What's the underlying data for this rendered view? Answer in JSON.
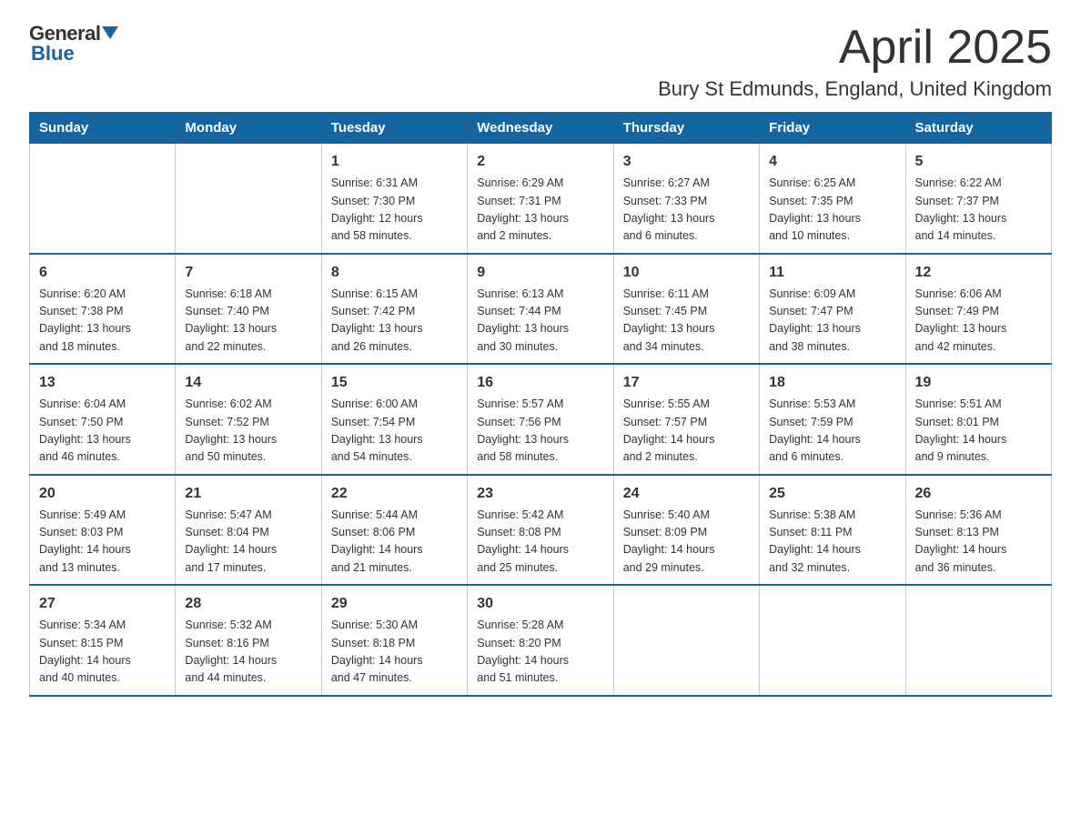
{
  "logo": {
    "general": "General",
    "blue": "Blue"
  },
  "header": {
    "month": "April 2025",
    "location": "Bury St Edmunds, England, United Kingdom"
  },
  "weekdays": [
    "Sunday",
    "Monday",
    "Tuesday",
    "Wednesday",
    "Thursday",
    "Friday",
    "Saturday"
  ],
  "weeks": [
    [
      {
        "day": "",
        "info": ""
      },
      {
        "day": "",
        "info": ""
      },
      {
        "day": "1",
        "info": "Sunrise: 6:31 AM\nSunset: 7:30 PM\nDaylight: 12 hours\nand 58 minutes."
      },
      {
        "day": "2",
        "info": "Sunrise: 6:29 AM\nSunset: 7:31 PM\nDaylight: 13 hours\nand 2 minutes."
      },
      {
        "day": "3",
        "info": "Sunrise: 6:27 AM\nSunset: 7:33 PM\nDaylight: 13 hours\nand 6 minutes."
      },
      {
        "day": "4",
        "info": "Sunrise: 6:25 AM\nSunset: 7:35 PM\nDaylight: 13 hours\nand 10 minutes."
      },
      {
        "day": "5",
        "info": "Sunrise: 6:22 AM\nSunset: 7:37 PM\nDaylight: 13 hours\nand 14 minutes."
      }
    ],
    [
      {
        "day": "6",
        "info": "Sunrise: 6:20 AM\nSunset: 7:38 PM\nDaylight: 13 hours\nand 18 minutes."
      },
      {
        "day": "7",
        "info": "Sunrise: 6:18 AM\nSunset: 7:40 PM\nDaylight: 13 hours\nand 22 minutes."
      },
      {
        "day": "8",
        "info": "Sunrise: 6:15 AM\nSunset: 7:42 PM\nDaylight: 13 hours\nand 26 minutes."
      },
      {
        "day": "9",
        "info": "Sunrise: 6:13 AM\nSunset: 7:44 PM\nDaylight: 13 hours\nand 30 minutes."
      },
      {
        "day": "10",
        "info": "Sunrise: 6:11 AM\nSunset: 7:45 PM\nDaylight: 13 hours\nand 34 minutes."
      },
      {
        "day": "11",
        "info": "Sunrise: 6:09 AM\nSunset: 7:47 PM\nDaylight: 13 hours\nand 38 minutes."
      },
      {
        "day": "12",
        "info": "Sunrise: 6:06 AM\nSunset: 7:49 PM\nDaylight: 13 hours\nand 42 minutes."
      }
    ],
    [
      {
        "day": "13",
        "info": "Sunrise: 6:04 AM\nSunset: 7:50 PM\nDaylight: 13 hours\nand 46 minutes."
      },
      {
        "day": "14",
        "info": "Sunrise: 6:02 AM\nSunset: 7:52 PM\nDaylight: 13 hours\nand 50 minutes."
      },
      {
        "day": "15",
        "info": "Sunrise: 6:00 AM\nSunset: 7:54 PM\nDaylight: 13 hours\nand 54 minutes."
      },
      {
        "day": "16",
        "info": "Sunrise: 5:57 AM\nSunset: 7:56 PM\nDaylight: 13 hours\nand 58 minutes."
      },
      {
        "day": "17",
        "info": "Sunrise: 5:55 AM\nSunset: 7:57 PM\nDaylight: 14 hours\nand 2 minutes."
      },
      {
        "day": "18",
        "info": "Sunrise: 5:53 AM\nSunset: 7:59 PM\nDaylight: 14 hours\nand 6 minutes."
      },
      {
        "day": "19",
        "info": "Sunrise: 5:51 AM\nSunset: 8:01 PM\nDaylight: 14 hours\nand 9 minutes."
      }
    ],
    [
      {
        "day": "20",
        "info": "Sunrise: 5:49 AM\nSunset: 8:03 PM\nDaylight: 14 hours\nand 13 minutes."
      },
      {
        "day": "21",
        "info": "Sunrise: 5:47 AM\nSunset: 8:04 PM\nDaylight: 14 hours\nand 17 minutes."
      },
      {
        "day": "22",
        "info": "Sunrise: 5:44 AM\nSunset: 8:06 PM\nDaylight: 14 hours\nand 21 minutes."
      },
      {
        "day": "23",
        "info": "Sunrise: 5:42 AM\nSunset: 8:08 PM\nDaylight: 14 hours\nand 25 minutes."
      },
      {
        "day": "24",
        "info": "Sunrise: 5:40 AM\nSunset: 8:09 PM\nDaylight: 14 hours\nand 29 minutes."
      },
      {
        "day": "25",
        "info": "Sunrise: 5:38 AM\nSunset: 8:11 PM\nDaylight: 14 hours\nand 32 minutes."
      },
      {
        "day": "26",
        "info": "Sunrise: 5:36 AM\nSunset: 8:13 PM\nDaylight: 14 hours\nand 36 minutes."
      }
    ],
    [
      {
        "day": "27",
        "info": "Sunrise: 5:34 AM\nSunset: 8:15 PM\nDaylight: 14 hours\nand 40 minutes."
      },
      {
        "day": "28",
        "info": "Sunrise: 5:32 AM\nSunset: 8:16 PM\nDaylight: 14 hours\nand 44 minutes."
      },
      {
        "day": "29",
        "info": "Sunrise: 5:30 AM\nSunset: 8:18 PM\nDaylight: 14 hours\nand 47 minutes."
      },
      {
        "day": "30",
        "info": "Sunrise: 5:28 AM\nSunset: 8:20 PM\nDaylight: 14 hours\nand 51 minutes."
      },
      {
        "day": "",
        "info": ""
      },
      {
        "day": "",
        "info": ""
      },
      {
        "day": "",
        "info": ""
      }
    ]
  ]
}
